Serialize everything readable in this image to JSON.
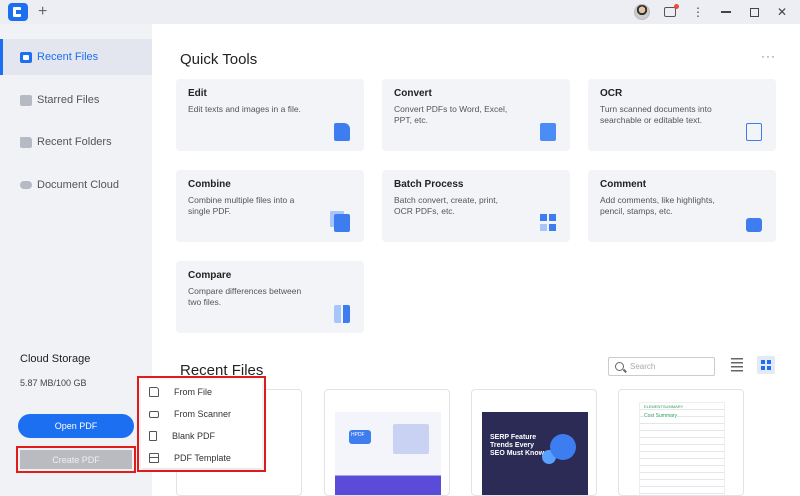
{
  "titlebar": {
    "new_tab": "+",
    "more": "⋮",
    "minimize": "",
    "maximize": "",
    "close": "✕"
  },
  "sidebar": {
    "items": [
      {
        "label": "Recent Files",
        "active": true
      },
      {
        "label": "Starred Files",
        "active": false
      },
      {
        "label": "Recent Folders",
        "active": false
      },
      {
        "label": "Document Cloud",
        "active": false
      }
    ],
    "cloud_storage_title": "Cloud Storage",
    "cloud_storage_usage": "5.87 MB/100 GB",
    "open_pdf": "Open PDF",
    "create_pdf": "Create PDF"
  },
  "quick_tools": {
    "title": "Quick Tools",
    "more": "···",
    "tools": [
      {
        "name": "Edit",
        "desc": "Edit texts and images in a file."
      },
      {
        "name": "Convert",
        "desc": "Convert PDFs to Word, Excel, PPT, etc."
      },
      {
        "name": "OCR",
        "desc": "Turn scanned documents into searchable or editable text."
      },
      {
        "name": "Combine",
        "desc": "Combine multiple files into a single PDF."
      },
      {
        "name": "Batch Process",
        "desc": "Batch convert, create, print, OCR PDFs, etc."
      },
      {
        "name": "Comment",
        "desc": "Add comments, like highlights, pencil, stamps, etc."
      },
      {
        "name": "Compare",
        "desc": "Compare differences between two files."
      }
    ]
  },
  "recent_files": {
    "title": "Recent Files",
    "search_placeholder": "Search",
    "thumbs": {
      "file2_logo": "HPDF",
      "file3_text": "SERP Feature Trends Every SEO Must Know",
      "file4_brand": "ELEMENTSUMMARY",
      "file4_title": "Cost Summary"
    }
  },
  "create_menu": {
    "items": [
      {
        "label": "From File"
      },
      {
        "label": "From Scanner"
      },
      {
        "label": "Blank PDF"
      },
      {
        "label": "PDF Template"
      }
    ]
  }
}
